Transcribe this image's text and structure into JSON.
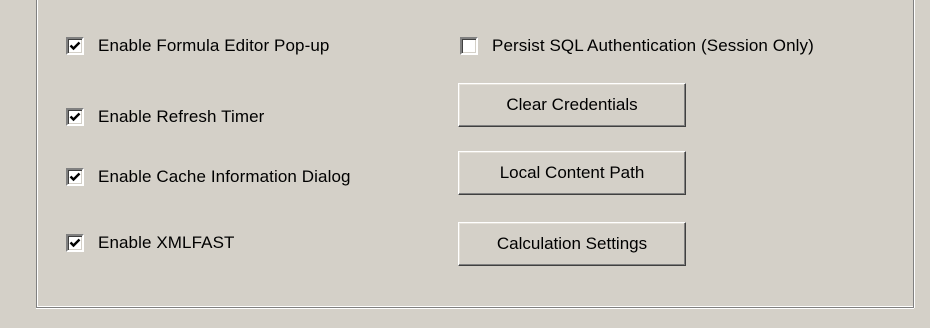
{
  "options": {
    "checkboxes": [
      {
        "label": "Enable Formula Editor Pop-up",
        "checked": true
      },
      {
        "label": "Enable Refresh Timer",
        "checked": true
      },
      {
        "label": "Enable Cache Information Dialog",
        "checked": true
      },
      {
        "label": "Enable XMLFAST",
        "checked": true
      },
      {
        "label": "Persist SQL Authentication (Session Only)",
        "checked": false
      }
    ],
    "buttons": [
      {
        "label": "Clear Credentials"
      },
      {
        "label": "Local Content Path"
      },
      {
        "label": "Calculation Settings"
      }
    ]
  },
  "colors": {
    "window_background": "#d4d0c8",
    "shadow": "#808080",
    "highlight": "#ffffff"
  }
}
